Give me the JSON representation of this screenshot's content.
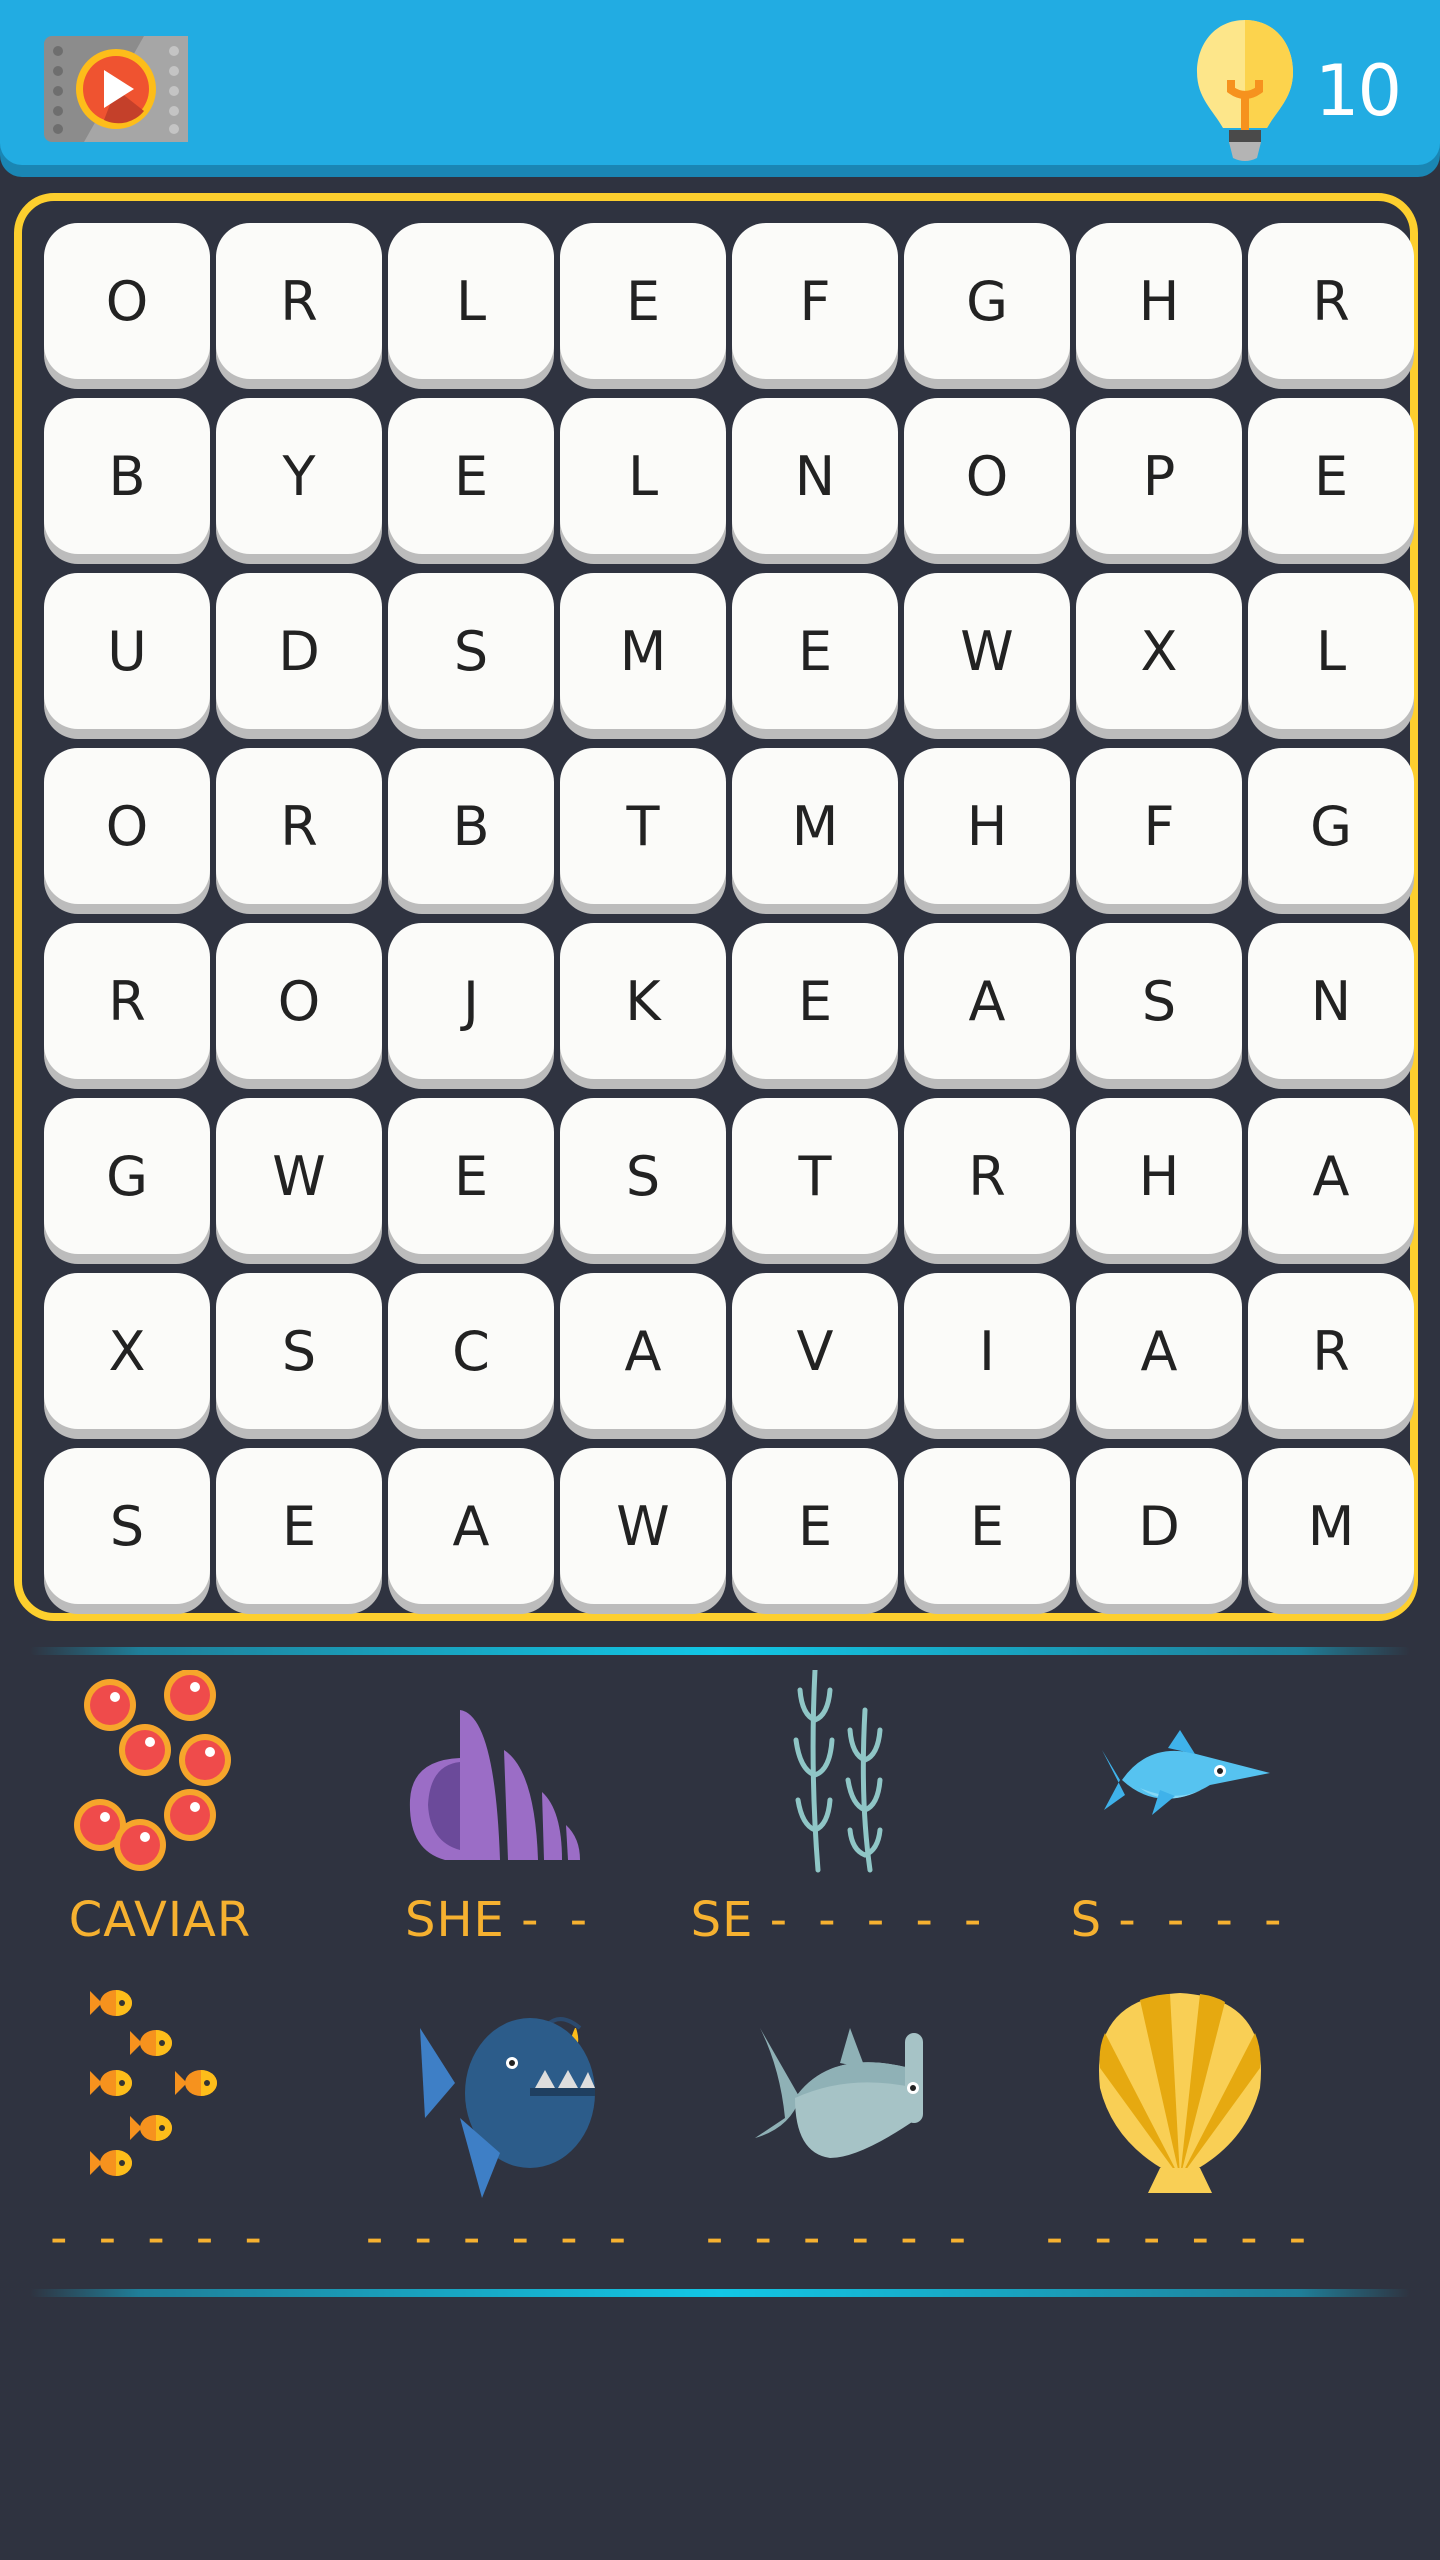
{
  "header": {
    "video_button_icon": "film-play-icon",
    "hint_icon": "lightbulb-icon",
    "hint_count": "10"
  },
  "board": {
    "rows": [
      [
        "O",
        "R",
        "L",
        "E",
        "F",
        "G",
        "H",
        "R"
      ],
      [
        "B",
        "Y",
        "E",
        "L",
        "N",
        "O",
        "P",
        "E"
      ],
      [
        "U",
        "D",
        "S",
        "M",
        "E",
        "W",
        "X",
        "L"
      ],
      [
        "O",
        "R",
        "B",
        "T",
        "M",
        "H",
        "F",
        "G"
      ],
      [
        "R",
        "O",
        "J",
        "K",
        "E",
        "A",
        "S",
        "N"
      ],
      [
        "G",
        "W",
        "E",
        "S",
        "T",
        "R",
        "H",
        "A"
      ],
      [
        "X",
        "S",
        "C",
        "A",
        "V",
        "I",
        "A",
        "R"
      ],
      [
        "S",
        "E",
        "A",
        "W",
        "E",
        "E",
        "D",
        "M"
      ]
    ]
  },
  "clues": [
    {
      "icon": "caviar-icon",
      "revealed": "CAVIAR",
      "hidden": ""
    },
    {
      "icon": "seashell-icon",
      "revealed": "SHE",
      "hidden": "- -"
    },
    {
      "icon": "seaweed-icon",
      "revealed": "SE",
      "hidden": "- - - - -"
    },
    {
      "icon": "swordfish-icon",
      "revealed": "S",
      "hidden": "- - - -"
    },
    {
      "icon": "fish-school-icon",
      "revealed": "",
      "hidden": "- - - - -"
    },
    {
      "icon": "anglerfish-icon",
      "revealed": "",
      "hidden": "- - - - - -"
    },
    {
      "icon": "hammerhead-shark-icon",
      "revealed": "",
      "hidden": "- - - - - -"
    },
    {
      "icon": "scallop-shell-icon",
      "revealed": "",
      "hidden": "- - - - - -"
    }
  ],
  "colors": {
    "header_bg": "#22ace2",
    "board_border": "#fdcf2e",
    "background": "#2f3340",
    "clue_text": "#f6b130"
  }
}
